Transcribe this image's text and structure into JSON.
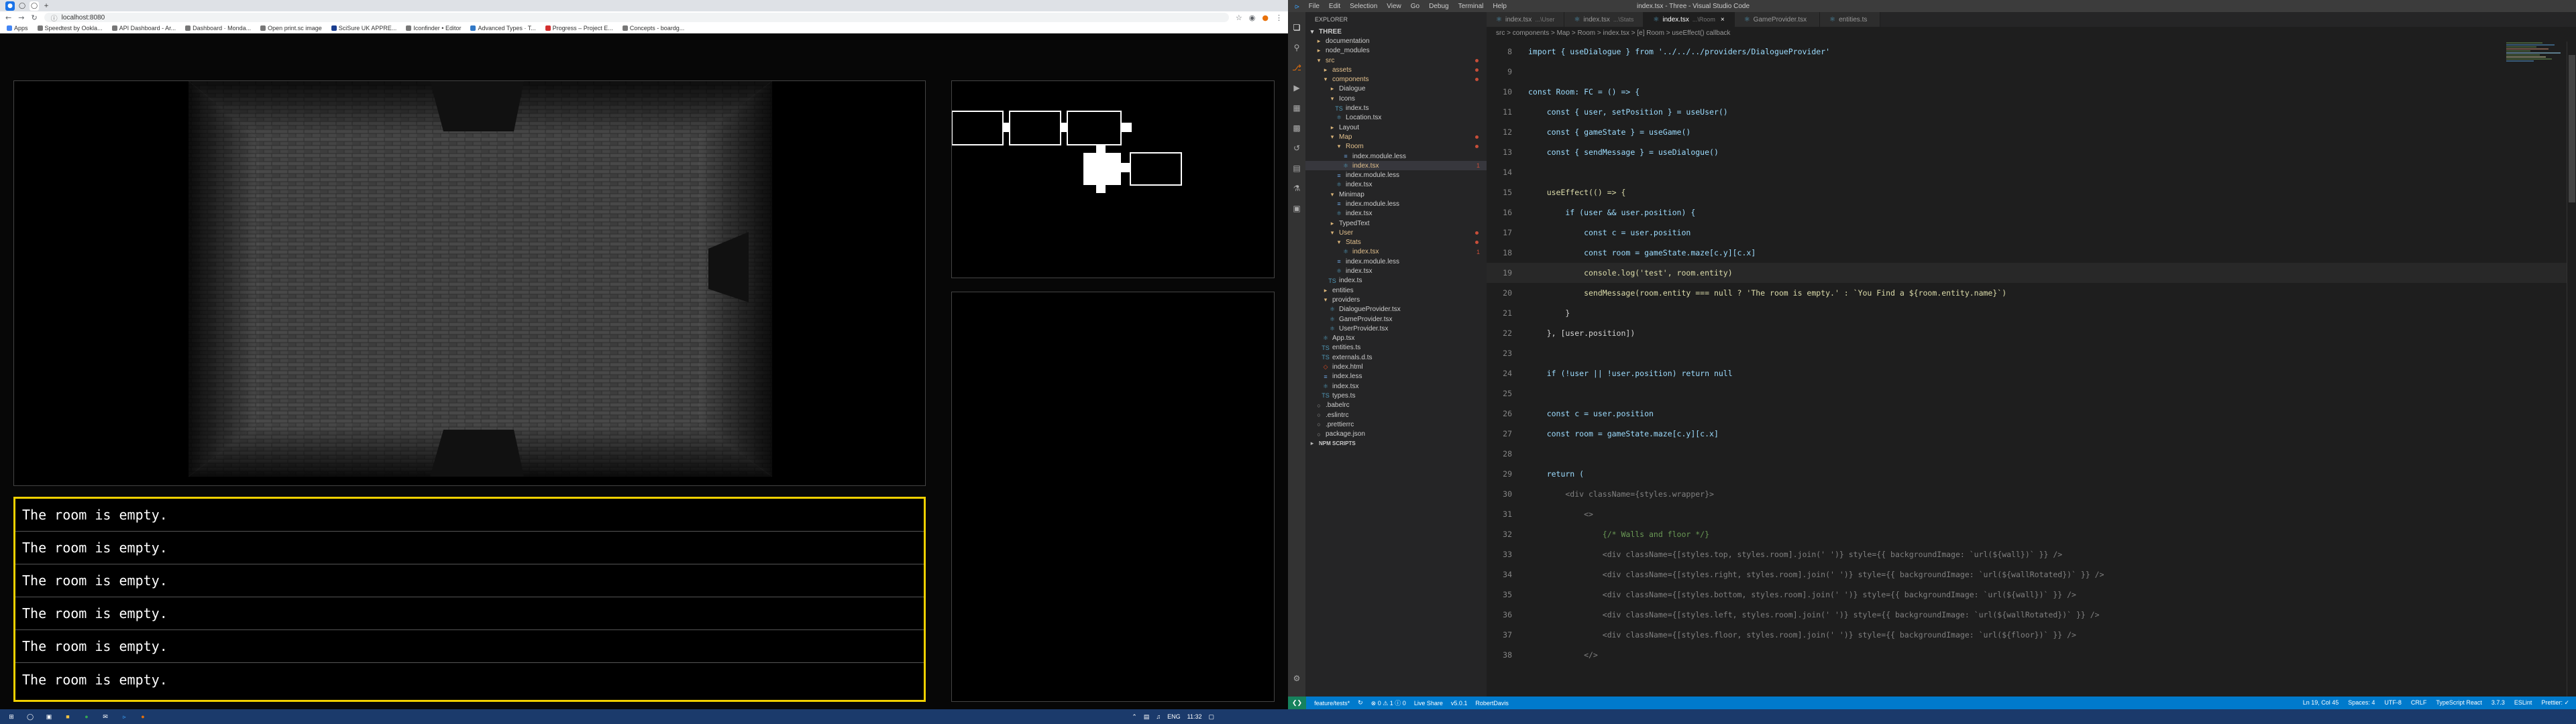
{
  "browser": {
    "tabs": [
      {
        "icon": "app-icon"
      },
      {
        "icon": "chrome-icon"
      },
      {
        "icon": "chrome-icon"
      },
      {
        "icon": "plus-icon",
        "label": "+"
      }
    ],
    "url": "localhost:8080",
    "bookmarks": [
      "Apps",
      "Speedtest by Ookla...",
      "API Dashboard - Ar...",
      "Dashboard · Monda...",
      "Open print.sc image",
      "SciSure UK APPRE...",
      "Iconfinder • Editor",
      "Advanced Types · T...",
      "Progress – Project E...",
      "Concepts - boardg..."
    ]
  },
  "game": {
    "dialog_lines": [
      "The room is empty.",
      "The room is empty.",
      "The room is empty.",
      "The room is empty.",
      "The room is empty.",
      "The room is empty."
    ]
  },
  "vscode": {
    "menu": [
      "File",
      "Edit",
      "Selection",
      "View",
      "Go",
      "Debug",
      "Terminal",
      "Help"
    ],
    "window_title": "index.tsx - Three - Visual Studio Code",
    "explorer_title": "EXPLORER",
    "workspace": "THREE",
    "tree": [
      {
        "label": "documentation",
        "depth": 1,
        "type": "folder"
      },
      {
        "label": "node_modules",
        "depth": 1,
        "type": "folder"
      },
      {
        "label": "src",
        "depth": 1,
        "type": "folder-open",
        "mod": "dot"
      },
      {
        "label": "assets",
        "depth": 2,
        "type": "folder",
        "mod": "dot"
      },
      {
        "label": "components",
        "depth": 2,
        "type": "folder-open",
        "mod": "dot"
      },
      {
        "label": "Dialogue",
        "depth": 3,
        "type": "folder"
      },
      {
        "label": "Icons",
        "depth": 3,
        "type": "folder-open"
      },
      {
        "label": "index.ts",
        "depth": 4,
        "type": "ts"
      },
      {
        "label": "Location.tsx",
        "depth": 4,
        "type": "tsx"
      },
      {
        "label": "Layout",
        "depth": 3,
        "type": "folder"
      },
      {
        "label": "Map",
        "depth": 3,
        "type": "folder-open",
        "mod": "dot"
      },
      {
        "label": "Room",
        "depth": 4,
        "type": "folder-open",
        "mod": "dot"
      },
      {
        "label": "index.module.less",
        "depth": 5,
        "type": "less"
      },
      {
        "label": "index.tsx",
        "depth": 5,
        "type": "tsx",
        "mod": "1",
        "sel": true
      },
      {
        "label": "index.module.less",
        "depth": 4,
        "type": "less"
      },
      {
        "label": "index.tsx",
        "depth": 4,
        "type": "tsx"
      },
      {
        "label": "Minimap",
        "depth": 3,
        "type": "folder-open"
      },
      {
        "label": "index.module.less",
        "depth": 4,
        "type": "less"
      },
      {
        "label": "index.tsx",
        "depth": 4,
        "type": "tsx"
      },
      {
        "label": "TypedText",
        "depth": 3,
        "type": "folder"
      },
      {
        "label": "User",
        "depth": 3,
        "type": "folder-open",
        "mod": "dot"
      },
      {
        "label": "Stats",
        "depth": 4,
        "type": "folder-open",
        "mod": "dot"
      },
      {
        "label": "index.tsx",
        "depth": 5,
        "type": "tsx",
        "mod": "1"
      },
      {
        "label": "index.module.less",
        "depth": 4,
        "type": "less"
      },
      {
        "label": "index.tsx",
        "depth": 4,
        "type": "tsx"
      },
      {
        "label": "index.ts",
        "depth": 3,
        "type": "ts"
      },
      {
        "label": "entities",
        "depth": 2,
        "type": "folder"
      },
      {
        "label": "providers",
        "depth": 2,
        "type": "folder-open"
      },
      {
        "label": "DialogueProvider.tsx",
        "depth": 3,
        "type": "tsx"
      },
      {
        "label": "GameProvider.tsx",
        "depth": 3,
        "type": "tsx"
      },
      {
        "label": "UserProvider.tsx",
        "depth": 3,
        "type": "tsx"
      },
      {
        "label": "App.tsx",
        "depth": 2,
        "type": "tsx"
      },
      {
        "label": "entities.ts",
        "depth": 2,
        "type": "ts"
      },
      {
        "label": "externals.d.ts",
        "depth": 2,
        "type": "ts"
      },
      {
        "label": "index.html",
        "depth": 2,
        "type": "html"
      },
      {
        "label": "index.less",
        "depth": 2,
        "type": "less"
      },
      {
        "label": "index.tsx",
        "depth": 2,
        "type": "tsx"
      },
      {
        "label": "types.ts",
        "depth": 2,
        "type": "ts"
      },
      {
        "label": ".babelrc",
        "depth": 1,
        "type": "file"
      },
      {
        "label": ".eslintrc",
        "depth": 1,
        "type": "file"
      },
      {
        "label": ".prettierrc",
        "depth": 1,
        "type": "file"
      },
      {
        "label": "package.json",
        "depth": 1,
        "type": "file"
      },
      {
        "label": "NPM SCRIPTS",
        "depth": 0,
        "type": "section"
      }
    ],
    "editor_tabs": [
      {
        "label": "index.tsx",
        "hint": "...\\User",
        "active": false
      },
      {
        "label": "index.tsx",
        "hint": "...\\Stats",
        "active": false
      },
      {
        "label": "index.tsx",
        "hint": "...\\Room",
        "active": true
      },
      {
        "label": "GameProvider.tsx",
        "hint": "",
        "active": false
      },
      {
        "label": "entities.ts",
        "hint": "",
        "active": false
      }
    ],
    "breadcrumbs": "src > components > Map > Room > index.tsx > [e] Room > useEffect() callback",
    "code_lines": [
      {
        "n": "8",
        "t": "import { useDialogue } from '../../../providers/DialogueProvider'"
      },
      {
        "n": "9",
        "t": ""
      },
      {
        "n": "10",
        "t": "const Room: FC = () => {"
      },
      {
        "n": "11",
        "t": "    const { user, setPosition } = useUser()"
      },
      {
        "n": "12",
        "t": "    const { gameState } = useGame()"
      },
      {
        "n": "13",
        "t": "    const { sendMessage } = useDialogue()"
      },
      {
        "n": "14",
        "t": ""
      },
      {
        "n": "15",
        "t": "    useEffect(() => {"
      },
      {
        "n": "16",
        "t": "        if (user && user.position) {"
      },
      {
        "n": "17",
        "t": "            const c = user.position"
      },
      {
        "n": "18",
        "t": "            const room = gameState.maze[c.y][c.x]"
      },
      {
        "n": "19",
        "t": "            console.log('test', room.entity)",
        "cur": true
      },
      {
        "n": "20",
        "t": "            sendMessage(room.entity === null ? 'The room is empty.' : `You Find a ${room.entity.name}`)"
      },
      {
        "n": "21",
        "t": "        }"
      },
      {
        "n": "22",
        "t": "    }, [user.position])"
      },
      {
        "n": "23",
        "t": ""
      },
      {
        "n": "24",
        "t": "    if (!user || !user.position) return null"
      },
      {
        "n": "25",
        "t": ""
      },
      {
        "n": "26",
        "t": "    const c = user.position"
      },
      {
        "n": "27",
        "t": "    const room = gameState.maze[c.y][c.x]"
      },
      {
        "n": "28",
        "t": ""
      },
      {
        "n": "29",
        "t": "    return ("
      },
      {
        "n": "30",
        "t": "        <div className={styles.wrapper}>"
      },
      {
        "n": "31",
        "t": "            <>"
      },
      {
        "n": "32",
        "t": "                {/* Walls and floor */}"
      },
      {
        "n": "33",
        "t": "                <div className={[styles.top, styles.room].join(' ')} style={{ backgroundImage: `url(${wall})` }} />"
      },
      {
        "n": "34",
        "t": "                <div className={[styles.right, styles.room].join(' ')} style={{ backgroundImage: `url(${wallRotated})` }} />"
      },
      {
        "n": "35",
        "t": "                <div className={[styles.bottom, styles.room].join(' ')} style={{ backgroundImage: `url(${wall})` }} />"
      },
      {
        "n": "36",
        "t": "                <div className={[styles.left, styles.room].join(' ')} style={{ backgroundImage: `url(${wallRotated})` }} />"
      },
      {
        "n": "37",
        "t": "                <div className={[styles.floor, styles.room].join(' ')} style={{ backgroundImage: `url(${floor})` }} />"
      },
      {
        "n": "38",
        "t": "            </>"
      }
    ],
    "status": {
      "branch": "feature/tests*",
      "sync": "↻",
      "problems": "⊗ 0 ⚠ 1 ⓘ 0",
      "liveshare": "Live Share",
      "version": "v5.0.1",
      "user": "RobertDavis",
      "right": [
        "Ln 19, Col 45",
        "Spaces: 4",
        "UTF-8",
        "CRLF",
        "TypeScript React",
        "3.7.3",
        "ESLint",
        "Prettier: ✓"
      ]
    }
  },
  "taskbar": {
    "tray_lang": "ENG",
    "time": "11:32"
  },
  "colors": {
    "dialog_border": "#f0d000",
    "vscode_status": "#007acc",
    "keyword": "#569cd6",
    "string": "#ce9178",
    "function": "#dcdcaa",
    "variable": "#9cdcfe",
    "comment": "#6a9955"
  }
}
